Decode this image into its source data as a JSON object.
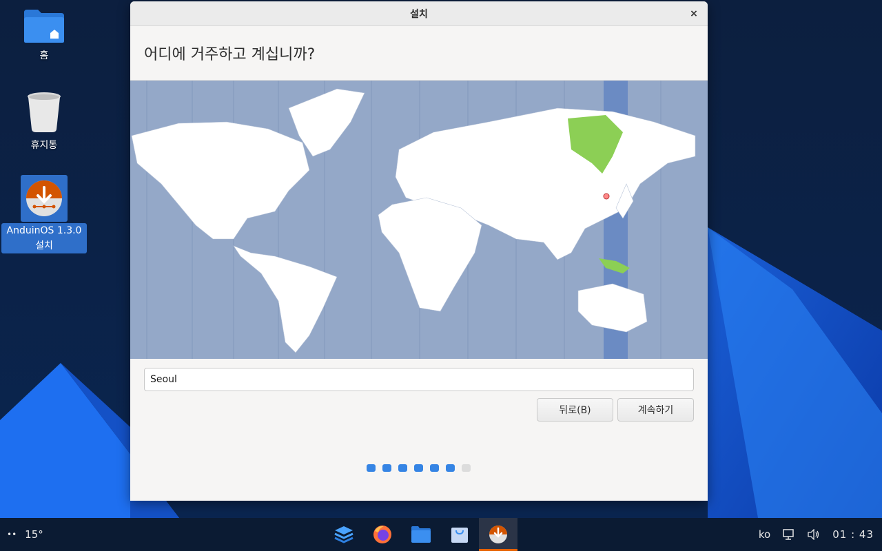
{
  "desktop": {
    "icons": [
      {
        "label": "홈",
        "icon": "home-folder-icon"
      },
      {
        "label": "휴지통",
        "icon": "trash-icon"
      },
      {
        "label": "AnduinOS 1.3.0 설치",
        "icon": "installer-icon"
      }
    ]
  },
  "dialog": {
    "title": "설치",
    "close_label": "×",
    "heading": "어디에 거주하고 계십니까?",
    "timezone_value": "Seoul",
    "back_label": "뒤로(B)",
    "continue_label": "계속하기",
    "progress": {
      "total": 7,
      "completed": 6
    },
    "map": {
      "selected_city": "Seoul",
      "highlight_color": "#8ccf55",
      "band_color": "#6b8bc3"
    }
  },
  "taskbar": {
    "weather_icon": "rain-icon",
    "temperature": "15°",
    "dock": [
      {
        "name": "workspaces-icon",
        "active": false
      },
      {
        "name": "firefox-icon",
        "active": false
      },
      {
        "name": "files-icon",
        "active": false
      },
      {
        "name": "software-store-icon",
        "active": false
      },
      {
        "name": "installer-icon",
        "active": true
      }
    ],
    "keyboard_layout": "ko",
    "network_icon": "network-icon",
    "volume_icon": "volume-icon",
    "clock": "01 : 43"
  },
  "colors": {
    "accent": "#3584e4",
    "installer_orange": "#e66100"
  }
}
